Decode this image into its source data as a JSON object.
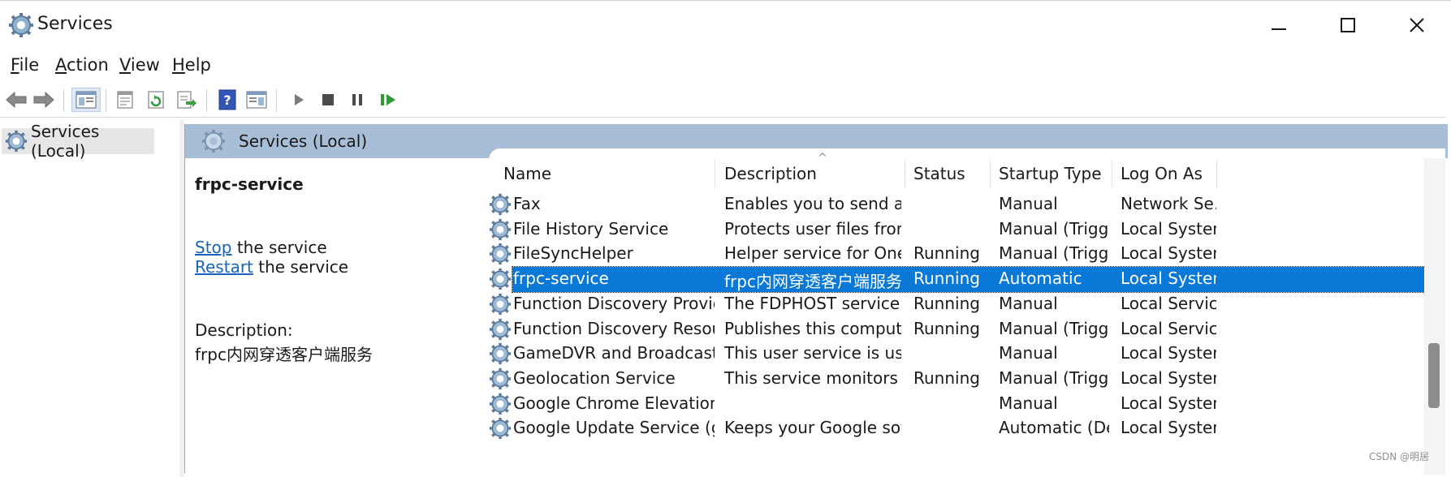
{
  "window": {
    "title": "Services"
  },
  "menu": {
    "file": {
      "mnemonic": "F",
      "rest": "ile"
    },
    "action": {
      "mnemonic": "A",
      "rest": "ction"
    },
    "view": {
      "mnemonic": "V",
      "rest": "iew"
    },
    "help": {
      "mnemonic": "H",
      "rest": "elp"
    }
  },
  "tree": {
    "root_label": "Services (Local)"
  },
  "header": {
    "label": "Services (Local)"
  },
  "detail": {
    "service_name": "frpc-service",
    "stop_link": "Stop",
    "stop_rest": " the service",
    "restart_link": "Restart",
    "restart_rest": " the service",
    "description_label": "Description:",
    "description_text": "frpc内网穿透客户端服务"
  },
  "columns": {
    "name": "Name",
    "description": "Description",
    "status": "Status",
    "startup_type": "Startup Type",
    "log_on_as": "Log On As"
  },
  "services": [
    {
      "name": "Fax",
      "description": "Enables you to send an…",
      "status": "",
      "startup_type": "Manual",
      "log_on_as": "Network Se…"
    },
    {
      "name": "File History Service",
      "description": "Protects user files from …",
      "status": "",
      "startup_type": "Manual (Trigg…",
      "log_on_as": "Local System"
    },
    {
      "name": "FileSyncHelper",
      "description": "Helper service for OneD…",
      "status": "Running",
      "startup_type": "Manual (Trigg…",
      "log_on_as": "Local System"
    },
    {
      "name": "frpc-service",
      "description": "frpc内网穿透客户端服务",
      "status": "Running",
      "startup_type": "Automatic",
      "log_on_as": "Local System",
      "selected": true
    },
    {
      "name": "Function Discovery Provider …",
      "description": "The FDPHOST service h…",
      "status": "Running",
      "startup_type": "Manual",
      "log_on_as": "Local Service"
    },
    {
      "name": "Function Discovery Resourc…",
      "description": "Publishes this computer…",
      "status": "Running",
      "startup_type": "Manual (Trigg…",
      "log_on_as": "Local Service"
    },
    {
      "name": "GameDVR and Broadcast Us…",
      "description": "This user service is used…",
      "status": "",
      "startup_type": "Manual",
      "log_on_as": "Local System"
    },
    {
      "name": "Geolocation Service",
      "description": "This service monitors th…",
      "status": "Running",
      "startup_type": "Manual (Trigg…",
      "log_on_as": "Local System"
    },
    {
      "name": "Google Chrome Elevation Se…",
      "description": "",
      "status": "",
      "startup_type": "Manual",
      "log_on_as": "Local System"
    },
    {
      "name": "Google Update Service (gup…",
      "description": "Keeps your Google soft…",
      "status": "",
      "startup_type": "Automatic (De…",
      "log_on_as": "Local System"
    }
  ],
  "watermark": "CSDN @明居",
  "colors": {
    "selection": "#0a78d7",
    "header_band": "#a7bed6",
    "link": "#1a64b8"
  }
}
